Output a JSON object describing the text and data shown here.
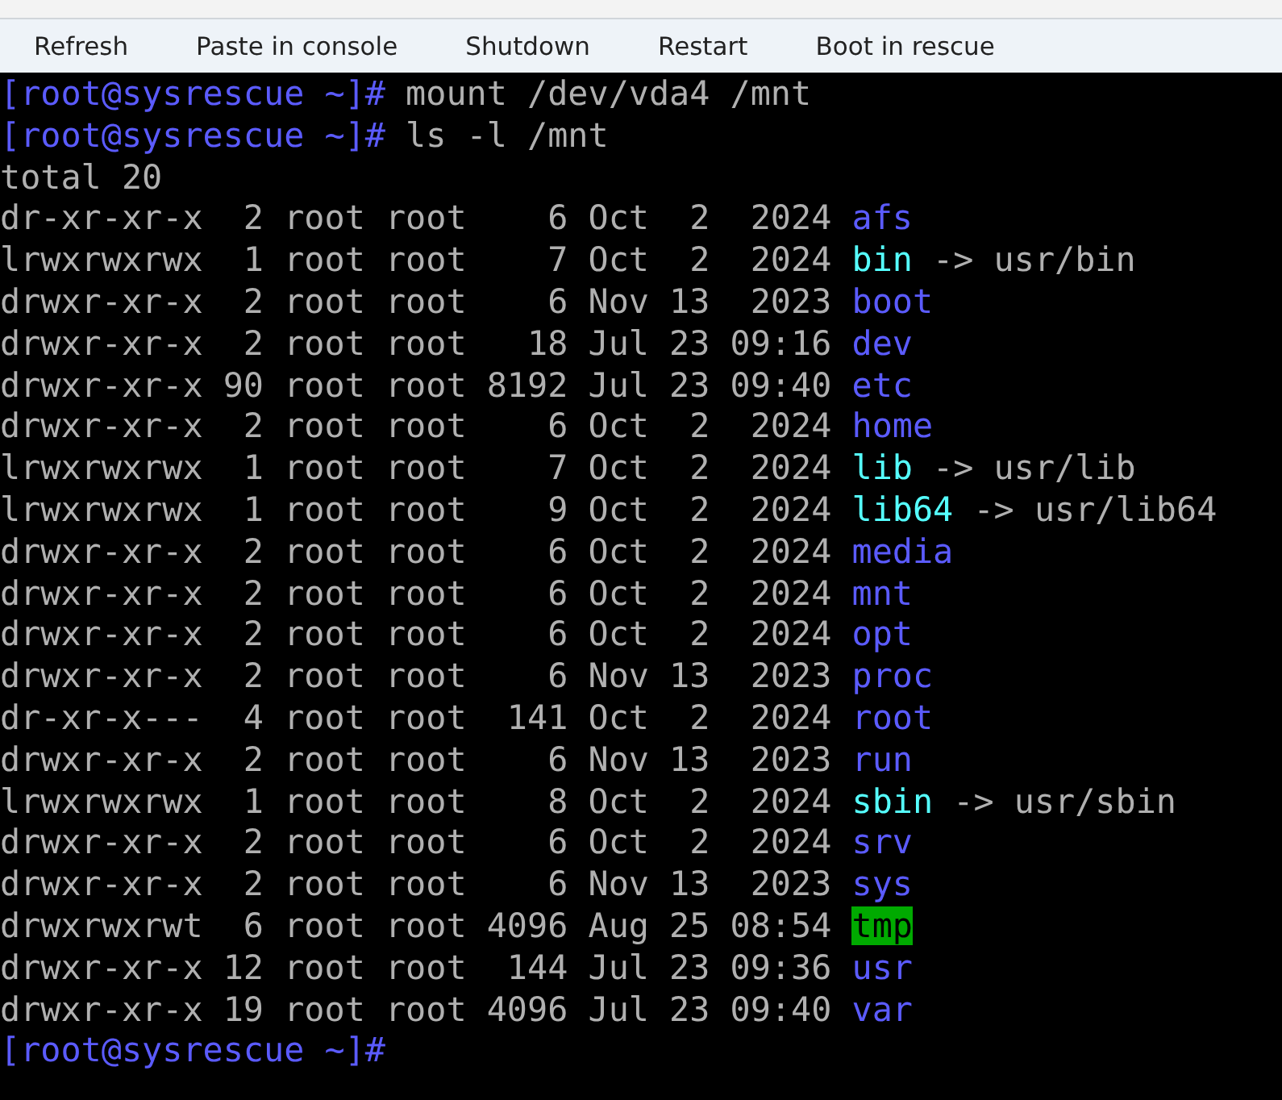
{
  "toolbar": {
    "buttons": [
      "Refresh",
      "Paste in console",
      "Shutdown",
      "Restart",
      "Boot in rescue"
    ]
  },
  "terminal": {
    "lines": [
      {
        "spans": [
          {
            "kind": "prompt",
            "text": "[root@sysrescue ~]#"
          },
          {
            "kind": "text",
            "text": " mount /dev/vda4 /mnt"
          }
        ]
      },
      {
        "spans": [
          {
            "kind": "prompt",
            "text": "[root@sysrescue ~]#"
          },
          {
            "kind": "text",
            "text": " ls -l /mnt"
          }
        ]
      },
      {
        "spans": [
          {
            "kind": "text",
            "text": "total 20"
          }
        ]
      },
      {
        "spans": [
          {
            "kind": "text",
            "text": "dr-xr-xr-x  2 root root    6 Oct  2  2024 "
          },
          {
            "kind": "dir",
            "text": "afs"
          }
        ]
      },
      {
        "spans": [
          {
            "kind": "text",
            "text": "lrwxrwxrwx  1 root root    7 Oct  2  2024 "
          },
          {
            "kind": "link",
            "text": "bin"
          },
          {
            "kind": "text",
            "text": " -> usr/bin"
          }
        ]
      },
      {
        "spans": [
          {
            "kind": "text",
            "text": "drwxr-xr-x  2 root root    6 Nov 13  2023 "
          },
          {
            "kind": "dir",
            "text": "boot"
          }
        ]
      },
      {
        "spans": [
          {
            "kind": "text",
            "text": "drwxr-xr-x  2 root root   18 Jul 23 09:16 "
          },
          {
            "kind": "dir",
            "text": "dev"
          }
        ]
      },
      {
        "spans": [
          {
            "kind": "text",
            "text": "drwxr-xr-x 90 root root 8192 Jul 23 09:40 "
          },
          {
            "kind": "dir",
            "text": "etc"
          }
        ]
      },
      {
        "spans": [
          {
            "kind": "text",
            "text": "drwxr-xr-x  2 root root    6 Oct  2  2024 "
          },
          {
            "kind": "dir",
            "text": "home"
          }
        ]
      },
      {
        "spans": [
          {
            "kind": "text",
            "text": "lrwxrwxrwx  1 root root    7 Oct  2  2024 "
          },
          {
            "kind": "link",
            "text": "lib"
          },
          {
            "kind": "text",
            "text": " -> usr/lib"
          }
        ]
      },
      {
        "spans": [
          {
            "kind": "text",
            "text": "lrwxrwxrwx  1 root root    9 Oct  2  2024 "
          },
          {
            "kind": "link",
            "text": "lib64"
          },
          {
            "kind": "text",
            "text": " -> usr/lib64"
          }
        ]
      },
      {
        "spans": [
          {
            "kind": "text",
            "text": "drwxr-xr-x  2 root root    6 Oct  2  2024 "
          },
          {
            "kind": "dir",
            "text": "media"
          }
        ]
      },
      {
        "spans": [
          {
            "kind": "text",
            "text": "drwxr-xr-x  2 root root    6 Oct  2  2024 "
          },
          {
            "kind": "dir",
            "text": "mnt"
          }
        ]
      },
      {
        "spans": [
          {
            "kind": "text",
            "text": "drwxr-xr-x  2 root root    6 Oct  2  2024 "
          },
          {
            "kind": "dir",
            "text": "opt"
          }
        ]
      },
      {
        "spans": [
          {
            "kind": "text",
            "text": "drwxr-xr-x  2 root root    6 Nov 13  2023 "
          },
          {
            "kind": "dir",
            "text": "proc"
          }
        ]
      },
      {
        "spans": [
          {
            "kind": "text",
            "text": "dr-xr-x---  4 root root  141 Oct  2  2024 "
          },
          {
            "kind": "dir",
            "text": "root"
          }
        ]
      },
      {
        "spans": [
          {
            "kind": "text",
            "text": "drwxr-xr-x  2 root root    6 Nov 13  2023 "
          },
          {
            "kind": "dir",
            "text": "run"
          }
        ]
      },
      {
        "spans": [
          {
            "kind": "text",
            "text": "lrwxrwxrwx  1 root root    8 Oct  2  2024 "
          },
          {
            "kind": "link",
            "text": "sbin"
          },
          {
            "kind": "text",
            "text": " -> usr/sbin"
          }
        ]
      },
      {
        "spans": [
          {
            "kind": "text",
            "text": "drwxr-xr-x  2 root root    6 Oct  2  2024 "
          },
          {
            "kind": "dir",
            "text": "srv"
          }
        ]
      },
      {
        "spans": [
          {
            "kind": "text",
            "text": "drwxr-xr-x  2 root root    6 Nov 13  2023 "
          },
          {
            "kind": "dir",
            "text": "sys"
          }
        ]
      },
      {
        "spans": [
          {
            "kind": "text",
            "text": "drwxrwxrwt  6 root root 4096 Aug 25 08:54 "
          },
          {
            "kind": "sticky",
            "text": "tmp"
          }
        ]
      },
      {
        "spans": [
          {
            "kind": "text",
            "text": "drwxr-xr-x 12 root root  144 Jul 23 09:36 "
          },
          {
            "kind": "dir",
            "text": "usr"
          }
        ]
      },
      {
        "spans": [
          {
            "kind": "text",
            "text": "drwxr-xr-x 19 root root 4096 Jul 23 09:40 "
          },
          {
            "kind": "dir",
            "text": "var"
          }
        ]
      },
      {
        "spans": [
          {
            "kind": "prompt",
            "text": "[root@sysrescue ~]#"
          }
        ]
      }
    ]
  }
}
